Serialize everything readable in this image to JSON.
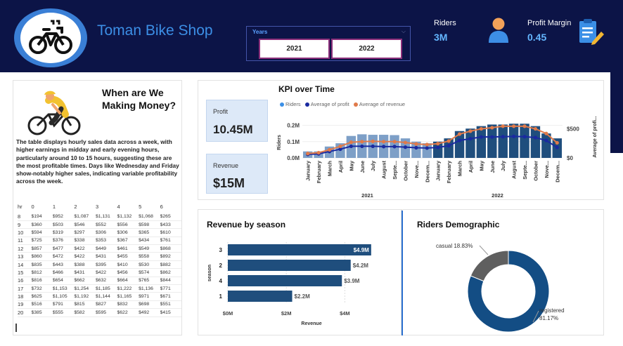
{
  "header": {
    "brand": "Toman Bike Shop",
    "slicer_title": "Years",
    "years": [
      "2021",
      "2022"
    ],
    "riders_label": "Riders",
    "riders_value": "3M",
    "profit_margin_label": "Profit Margin",
    "profit_margin_value": "0.45"
  },
  "left": {
    "title": "When are We Making Money?",
    "description": "The table displays hourly sales data across a week, with higher earnings in midday and early evening hours, particularly around 10 to 15 hours, suggesting these are the most profitable times. Days like Wednesday and Friday show-notably higher sales, indicating variable profitability across the week.",
    "table_headers": [
      "hr",
      "0",
      "1",
      "2",
      "3",
      "4",
      "5",
      "6"
    ],
    "table_rows": [
      [
        "8",
        "$194",
        "$952",
        "$1,087",
        "$1,131",
        "$1,132",
        "$1,068",
        "$265"
      ],
      [
        "9",
        "$360",
        "$503",
        "$546",
        "$552",
        "$556",
        "$598",
        "$433"
      ],
      [
        "10",
        "$594",
        "$319",
        "$297",
        "$306",
        "$306",
        "$365",
        "$610"
      ],
      [
        "11",
        "$725",
        "$376",
        "$338",
        "$353",
        "$367",
        "$434",
        "$761"
      ],
      [
        "12",
        "$857",
        "$477",
        "$422",
        "$449",
        "$461",
        "$549",
        "$868"
      ],
      [
        "13",
        "$860",
        "$472",
        "$422",
        "$431",
        "$455",
        "$558",
        "$892"
      ],
      [
        "14",
        "$835",
        "$443",
        "$388",
        "$395",
        "$410",
        "$530",
        "$882"
      ],
      [
        "15",
        "$812",
        "$466",
        "$431",
        "$422",
        "$456",
        "$574",
        "$862"
      ],
      [
        "16",
        "$816",
        "$654",
        "$662",
        "$632",
        "$664",
        "$765",
        "$844"
      ],
      [
        "17",
        "$732",
        "$1,153",
        "$1,254",
        "$1,185",
        "$1,222",
        "$1,136",
        "$771"
      ],
      [
        "18",
        "$625",
        "$1,105",
        "$1,192",
        "$1,144",
        "$1,165",
        "$971",
        "$671"
      ],
      [
        "19",
        "$516",
        "$791",
        "$815",
        "$827",
        "$832",
        "$698",
        "$551"
      ],
      [
        "20",
        "$385",
        "$555",
        "$582",
        "$595",
        "$622",
        "$492",
        "$415"
      ]
    ]
  },
  "kpi": {
    "profit_label": "Profit",
    "profit_value": "10.45M",
    "revenue_label": "Revenue",
    "revenue_value": "$15M"
  },
  "chart_data": [
    {
      "type": "bar",
      "title": "KPI over Time",
      "legend": [
        "Riders",
        "Average of profit",
        "Average of revenue"
      ],
      "ylabel": "Riders",
      "y2label": "Average of profi...",
      "yticks": [
        "0.0M",
        "0.1M",
        "0.2M"
      ],
      "y2ticks": [
        "$0",
        "$500"
      ],
      "ylim": [
        0,
        0.25
      ],
      "y2lim": [
        0,
        700
      ],
      "categories": [
        "January",
        "February",
        "March",
        "April",
        "May",
        "June",
        "July",
        "August",
        "Septe...",
        "October",
        "Nove...",
        "Decem...",
        "January",
        "February",
        "March",
        "April",
        "May",
        "June",
        "July",
        "August",
        "Septe...",
        "October",
        "Nove...",
        "Decem..."
      ],
      "years": [
        "2021",
        "2022"
      ],
      "series": [
        {
          "name": "Riders",
          "values": [
            0.04,
            0.04,
            0.07,
            0.09,
            0.135,
            0.145,
            0.142,
            0.142,
            0.14,
            0.12,
            0.1,
            0.09,
            0.1,
            0.12,
            0.165,
            0.18,
            0.195,
            0.205,
            0.205,
            0.21,
            0.21,
            0.195,
            0.15,
            0.12
          ]
        },
        {
          "name": "Average of profit",
          "values": [
            60,
            70,
            110,
            150,
            200,
            200,
            200,
            195,
            195,
            185,
            175,
            170,
            180,
            210,
            300,
            330,
            360,
            360,
            365,
            370,
            365,
            350,
            300,
            180
          ]
        },
        {
          "name": "Average of revenue",
          "values": [
            75,
            90,
            140,
            200,
            270,
            280,
            285,
            280,
            280,
            265,
            240,
            230,
            245,
            290,
            410,
            460,
            500,
            520,
            545,
            545,
            545,
            500,
            420,
            260
          ]
        }
      ],
      "colors": {
        "riders_2021": "#7d9fc7",
        "riders_2022": "#1f4e7d",
        "profit": "#1a2aa0",
        "revenue": "#e07a4a"
      }
    },
    {
      "type": "bar",
      "title": "Revenue by season",
      "xlabel": "Revenue",
      "ylabel": "season",
      "categories": [
        "3",
        "2",
        "4",
        "1"
      ],
      "values": [
        4.9,
        4.2,
        3.9,
        2.2
      ],
      "data_labels": [
        "$4.9M",
        "$4.2M",
        "$3.9M",
        "$2.2M"
      ],
      "xticks": [
        "$0M",
        "$2M",
        "$4M"
      ],
      "xlim": [
        0,
        5
      ],
      "color": "#1f4e7d"
    },
    {
      "type": "pie",
      "title": "Riders Demographic",
      "categories": [
        "casual",
        "registered"
      ],
      "values": [
        18.83,
        81.17
      ],
      "labels": [
        "casual 18.83%",
        "registered",
        "81.17%"
      ],
      "colors": [
        "#5f5f5f",
        "#134d84"
      ]
    }
  ]
}
